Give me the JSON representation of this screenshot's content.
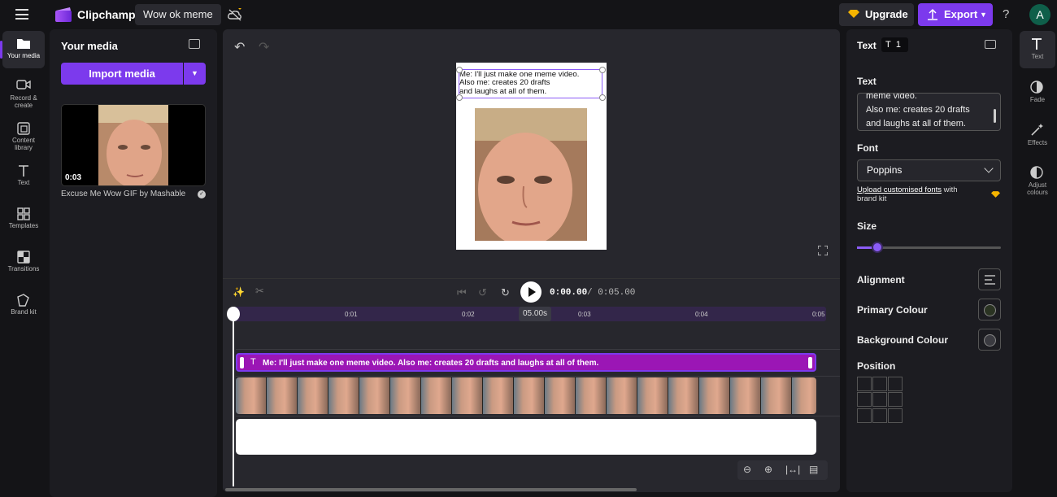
{
  "topbar": {
    "app_name": "Clipchamp",
    "project_name": "Wow ok meme",
    "upgrade_label": "Upgrade",
    "export_label": "Export",
    "help_glyph": "?",
    "avatar_initial": "A",
    "accent_color": "#7c3aed"
  },
  "leftnav": [
    {
      "label": "Your media",
      "icon": "folder-icon"
    },
    {
      "label": "Record & create",
      "icon": "video-camera-icon"
    },
    {
      "label": "Content library",
      "icon": "library-icon"
    },
    {
      "label": "Text",
      "icon": "text-icon"
    },
    {
      "label": "Templates",
      "icon": "templates-icon"
    },
    {
      "label": "Transitions",
      "icon": "transitions-icon"
    },
    {
      "label": "Brand kit",
      "icon": "brand-kit-icon"
    }
  ],
  "media": {
    "title": "Your media",
    "import_label": "Import media",
    "item_duration": "0:03",
    "item_name": "Excuse Me Wow GIF by Mashable"
  },
  "canvas": {
    "lines": [
      "Me: I'll just make one meme video.",
      "Also me: creates 20 drafts",
      "and laughs at all of them."
    ]
  },
  "timeline": {
    "current_time": "0:00.00",
    "total_time": "/ 0:05.00",
    "ticks": [
      "0:01",
      "0:02",
      "0:03",
      "0:04",
      "0:05"
    ],
    "current_caption": "05.00s",
    "text_clip": "Me: I'll just make one meme video. Also me: creates 20 drafts and laughs at all of them.",
    "text_clip_color": "#9b16b5",
    "frame_count": 19
  },
  "props": {
    "header": "Text",
    "header_count": "1",
    "text_label": "Text",
    "text_lines": [
      "meme video.",
      "Also me: creates 20 drafts",
      "and laughs at all of them."
    ],
    "font_label": "Font",
    "font_value": "Poppins",
    "upload_link": "Upload customised fonts",
    "upload_suffix": " with brand kit",
    "size_label": "Size",
    "size_level": 0.14,
    "alignment_label": "Alignment",
    "primary_label": "Primary Colour",
    "primary_color": "#2a3322",
    "background_label": "Background Colour",
    "background_color": "#3a3a40",
    "position_label": "Position"
  },
  "rightnav": [
    {
      "label": "Text",
      "icon": "text-icon"
    },
    {
      "label": "Fade",
      "icon": "fade-icon"
    },
    {
      "label": "Effects",
      "icon": "effects-wand-icon"
    },
    {
      "label": "Adjust colours",
      "icon": "adjust-colours-icon"
    }
  ]
}
